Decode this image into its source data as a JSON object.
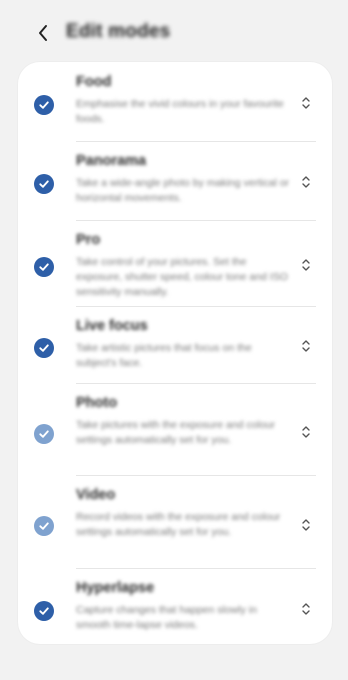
{
  "header": {
    "title": "Edit modes"
  },
  "colors": {
    "check_dark": "#2e5fa8",
    "check_light": "#7fa2cf"
  },
  "modes": [
    {
      "label": "Food",
      "description": "Emphasise the vivid colours in your favourite foods.",
      "checked": true,
      "tone": "dark"
    },
    {
      "label": "Panorama",
      "description": "Take a wide-angle photo by making vertical or horizontal movements.",
      "checked": true,
      "tone": "dark"
    },
    {
      "label": "Pro",
      "description": "Take control of your pictures. Set the exposure, shutter speed, colour tone and ISO sensitivity manually.",
      "checked": true,
      "tone": "dark"
    },
    {
      "label": "Live focus",
      "description": "Take artistic pictures that focus on the subject's face.",
      "checked": true,
      "tone": "dark"
    },
    {
      "label": "Photo",
      "description": "Take pictures with the exposure and colour settings automatically set for you.",
      "checked": true,
      "tone": "light"
    },
    {
      "label": "Video",
      "description": "Record videos with the exposure and colour settings automatically set for you.",
      "checked": true,
      "tone": "light"
    },
    {
      "label": "Hyperlapse",
      "description": "Capture changes that happen slowly in smooth time-lapse videos.",
      "checked": true,
      "tone": "dark"
    }
  ]
}
